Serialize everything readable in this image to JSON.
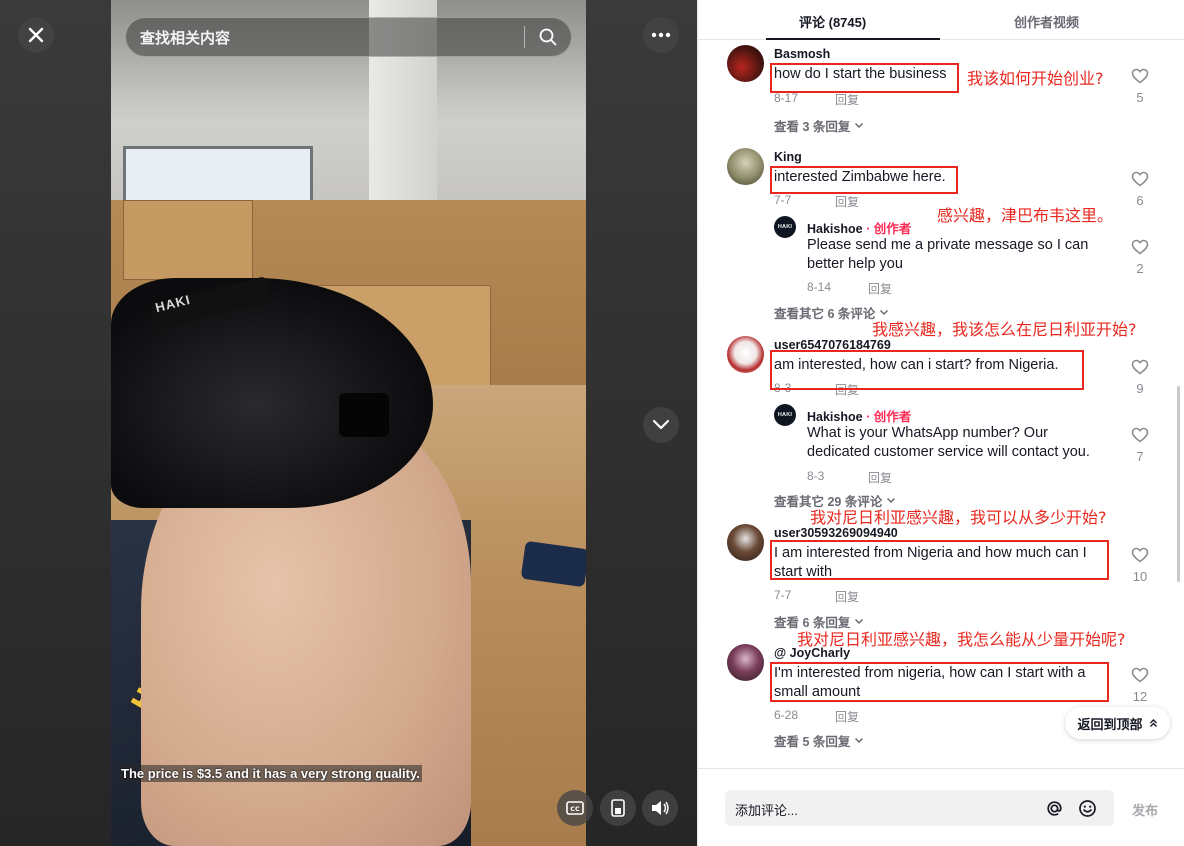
{
  "video": {
    "search_placeholder": "查找相关内容",
    "subtitle": "The price is $3.5 and it has a very strong quality.",
    "product_brand": "HAKI",
    "strap_brand": "HAKI"
  },
  "tabs": {
    "comments": "评论 (8745)",
    "creator_videos": "创作者视频"
  },
  "comments": [
    {
      "author": "Basmosh",
      "text": "how do I start the business",
      "date": "8-17",
      "reply": "回复",
      "likes": "5",
      "view_replies": "查看 3 条回复",
      "annotation": "我该如何开始创业?"
    },
    {
      "author": "King",
      "text": "interested Zimbabwe here.",
      "date": "7-7",
      "reply": "回复",
      "likes": "6",
      "annotation": "感兴趣，津巴布韦这里。",
      "creator_reply": {
        "author": "Hakishoe",
        "tag": "· 创作者",
        "text": "Please send me a private message so I can better help you",
        "date": "8-14",
        "reply": "回复",
        "likes": "2"
      },
      "view_replies": "查看其它 6 条评论"
    },
    {
      "author": "user6547076184769",
      "text": "am interested, how can i start? from Nigeria.",
      "date": "8-3",
      "reply": "回复",
      "likes": "9",
      "annotation": "我感兴趣，我该怎么在尼日利亚开始?",
      "creator_reply": {
        "author": "Hakishoe",
        "tag": "· 创作者",
        "text": "What is your WhatsApp number? Our dedicated customer service will contact you.",
        "date": "8-3",
        "reply": "回复",
        "likes": "7"
      },
      "view_replies": "查看其它 29 条评论"
    },
    {
      "author": "user30593269094940",
      "text": "I am interested from Nigeria and how much can I start with",
      "date": "7-7",
      "reply": "回复",
      "likes": "10",
      "view_replies": "查看 6 条回复",
      "annotation": "我对尼日利亚感兴趣，我可以从多少开始?"
    },
    {
      "author": "@ JoyCharly",
      "text": "I'm interested from nigeria, how can I start with a small amount",
      "date": "6-28",
      "reply": "回复",
      "likes": "12",
      "view_replies": "查看 5 条回复",
      "annotation": "我对尼日利亚感兴趣，我怎么能从少量开始呢?"
    }
  ],
  "back_to_top": "返回到顶部",
  "input": {
    "placeholder": "添加评论...",
    "publish": "发布"
  },
  "colors": {
    "accent_red": "#fe2c55",
    "annotation_red": "#e8281f"
  }
}
